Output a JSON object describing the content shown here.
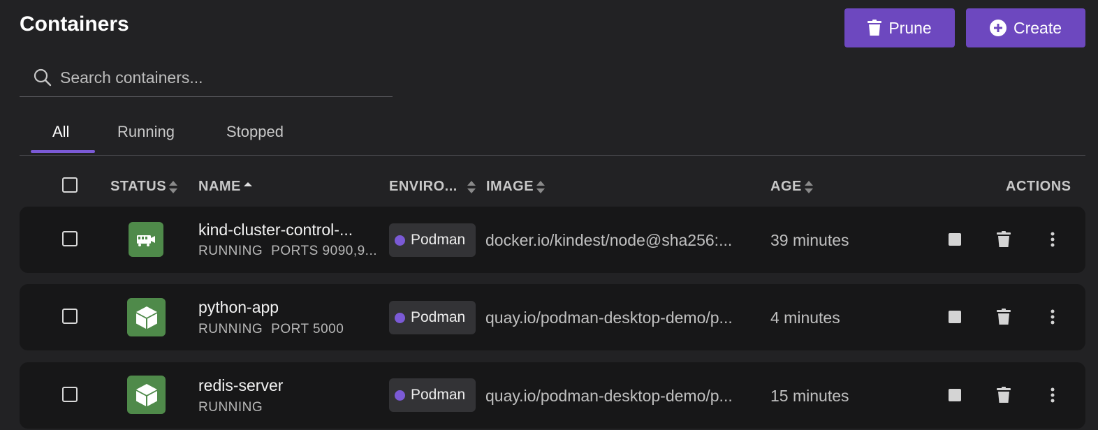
{
  "page": {
    "title": "Containers"
  },
  "toolbar": {
    "prune_label": "Prune",
    "create_label": "Create"
  },
  "search": {
    "placeholder": "Search containers...",
    "value": ""
  },
  "tabs": [
    {
      "label": "All",
      "active": true
    },
    {
      "label": "Running",
      "active": false
    },
    {
      "label": "Stopped",
      "active": false
    }
  ],
  "columns": {
    "status": "STATUS",
    "name": "NAME",
    "environment": "ENVIRO...",
    "image": "IMAGE",
    "age": "AGE",
    "actions": "ACTIONS"
  },
  "rows": [
    {
      "name": "kind-cluster-control-...",
      "state": "RUNNING",
      "ports": "PORTS 9090,9...",
      "environment": "Podman",
      "image": "docker.io/kindest/node@sha256:...",
      "age": "39 minutes",
      "icon": "pod-icon"
    },
    {
      "name": "python-app",
      "state": "RUNNING",
      "ports": "PORT 5000",
      "environment": "Podman",
      "image": "quay.io/podman-desktop-demo/p...",
      "age": "4 minutes",
      "icon": "container-icon"
    },
    {
      "name": "redis-server",
      "state": "RUNNING",
      "ports": "",
      "environment": "Podman",
      "image": "quay.io/podman-desktop-demo/p...",
      "age": "15 minutes",
      "icon": "container-icon"
    }
  ],
  "colors": {
    "accent": "#6d48bf",
    "status_running": "#4f8a4a",
    "env_dot": "#7b5ad6"
  }
}
